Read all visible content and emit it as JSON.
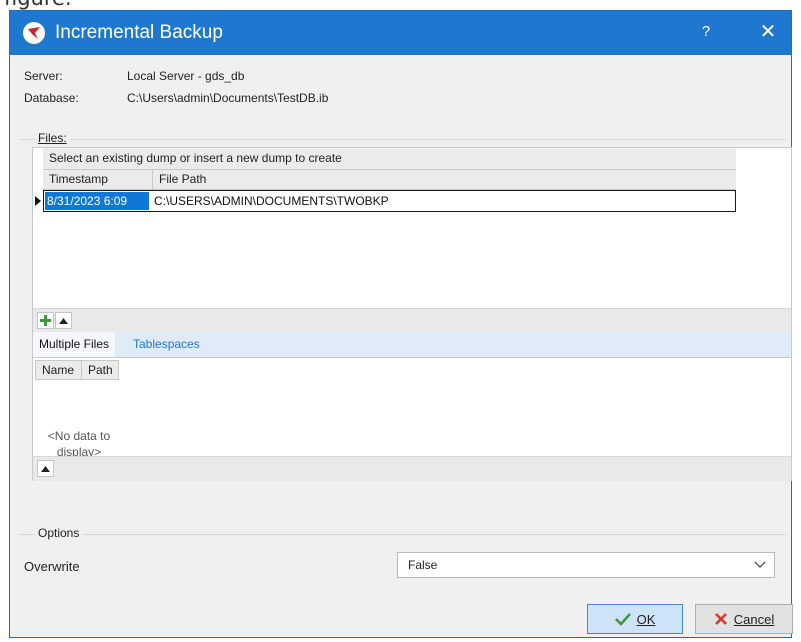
{
  "page_caption": "figure.",
  "window": {
    "title": "Incremental Backup",
    "help_label": "?",
    "close_label": "✕"
  },
  "info": {
    "server_label": "Server:",
    "server_value": "Local Server - gds_db",
    "database_label": "Database:",
    "database_value": "C:\\Users\\admin\\Documents\\TestDB.ib"
  },
  "files": {
    "legend": "Files:",
    "grid_caption": "Select an existing dump or insert a new dump to create",
    "columns": [
      "Timestamp",
      "File Path"
    ],
    "rows": [
      {
        "timestamp": "8/31/2023 6:09",
        "file_path": "C:\\USERS\\ADMIN\\DOCUMENTS\\TWOBKP"
      }
    ]
  },
  "tabs": [
    {
      "label": "Multiple Files",
      "active": true
    },
    {
      "label": "Tablespaces",
      "active": false
    }
  ],
  "multiple_files": {
    "columns": [
      "Name",
      "Path"
    ],
    "empty_line1": "<No data to",
    "empty_line2": "display>"
  },
  "options": {
    "legend": "Options",
    "overwrite_label": "Overwrite",
    "overwrite_value": "False"
  },
  "buttons": {
    "ok_label": "OK",
    "cancel_label": "Cancel"
  },
  "colors": {
    "titlebar": "#1f78cf",
    "selection": "#0f78d7",
    "ok_check": "#3c9a3c",
    "cancel_x": "#d9342b"
  }
}
